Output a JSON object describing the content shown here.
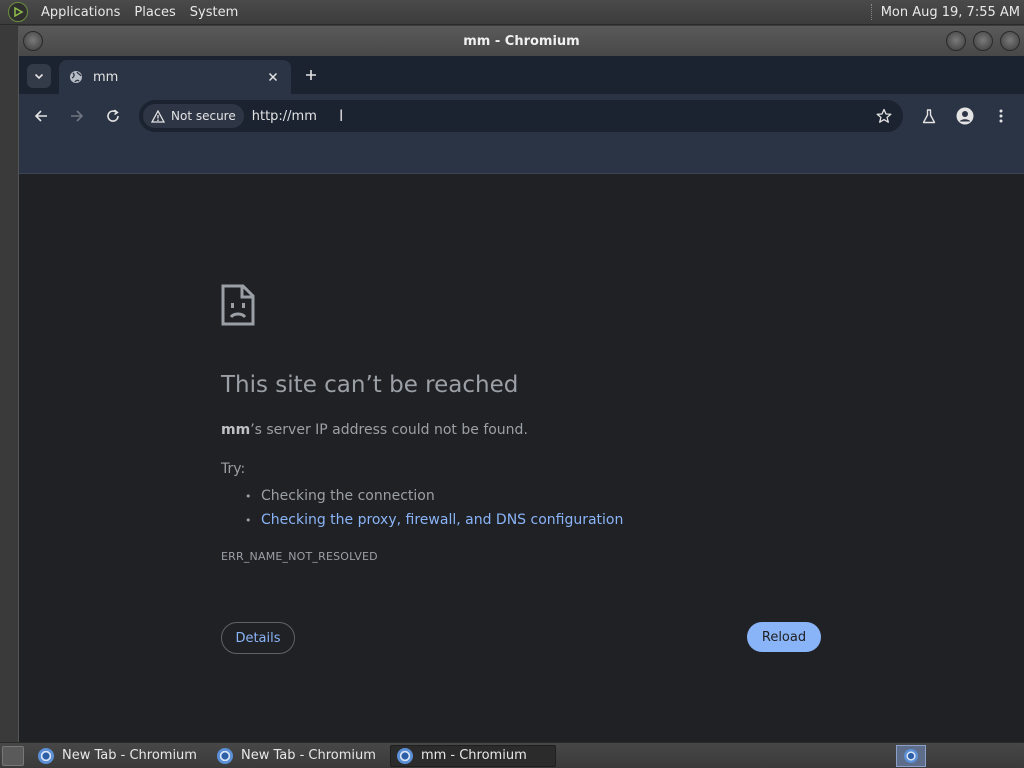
{
  "top_panel": {
    "menus": [
      "Applications",
      "Places",
      "System"
    ],
    "clock": "Mon Aug 19,  7:55 AM"
  },
  "window": {
    "title": "mm - Chromium"
  },
  "browser": {
    "tab": {
      "title": "mm"
    },
    "omnibox": {
      "security_chip": "Not secure",
      "url": "http://mm"
    }
  },
  "error_page": {
    "heading": "This site can’t be reached",
    "host": "mm",
    "description_rest": "’s server IP address could not be found.",
    "try_label": "Try:",
    "suggestions": [
      "Checking the connection",
      "Checking the proxy, firewall, and DNS configuration"
    ],
    "error_code": "ERR_NAME_NOT_RESOLVED",
    "details_label": "Details",
    "reload_label": "Reload"
  },
  "taskbar": {
    "tasks": [
      "New Tab - Chromium",
      "New Tab - Chromium",
      "mm - Chromium"
    ]
  },
  "colors": {
    "page_bg": "#202124",
    "toolbar_bg": "#2b3444",
    "link": "#8ab4f8",
    "text": "#9aa0a6"
  }
}
